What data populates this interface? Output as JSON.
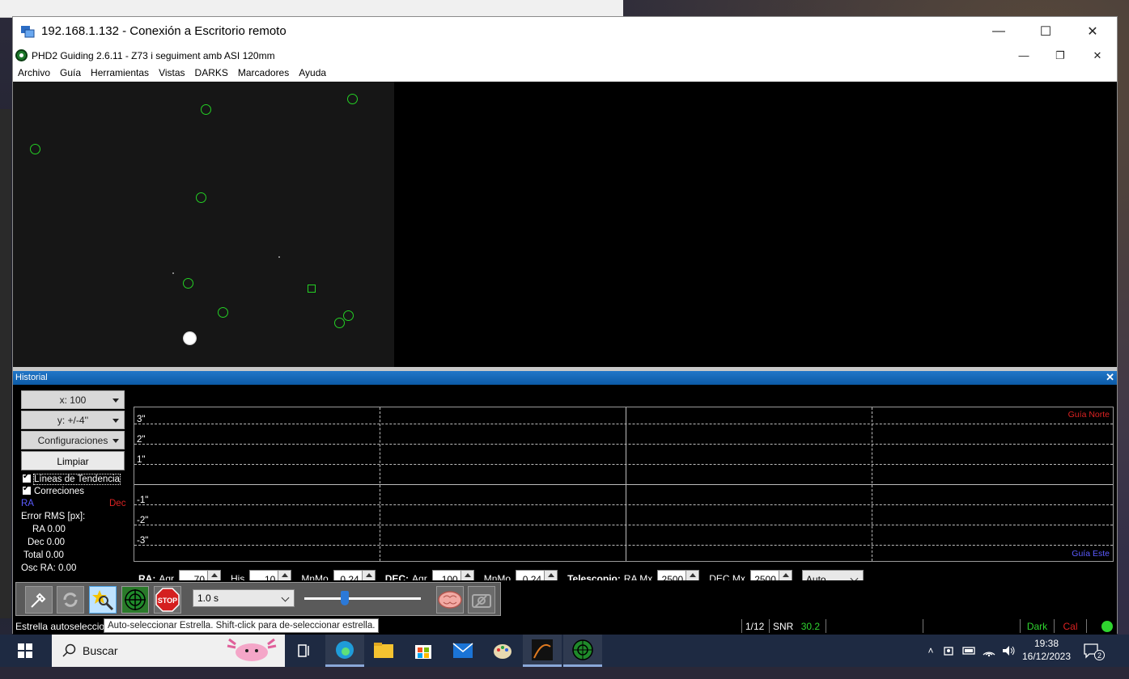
{
  "remote_window": {
    "title": "192.168.1.132 - Conexión a Escritorio remoto",
    "controls": {
      "minimize": "—",
      "maximize": "☐",
      "close": "✕"
    }
  },
  "app": {
    "title": "PHD2 Guiding 2.6.11 - Z73 i seguiment amb ASI 120mm",
    "controls": {
      "minimize": "—",
      "restore": "❐",
      "close": "✕"
    },
    "menu": [
      "Archivo",
      "Guía",
      "Herramientas",
      "Vistas",
      "DARKS",
      "Marcadores",
      "Ayuda"
    ]
  },
  "history": {
    "title": "Historial",
    "close": "✕",
    "x_scale": "x: 100",
    "y_scale": "y: +/-4''",
    "settings": "Configuraciones",
    "clear": "Limpiar",
    "trend_lines": "Líneas de Tendencia",
    "corrections": "Correciones",
    "ra_label": "RA",
    "dec_label": "Dec",
    "rms_title": "Error RMS [px]:",
    "rms_ra": "RA 0.00",
    "rms_dec": "Dec 0.00",
    "rms_total": "Total 0.00",
    "osc_ra": "Osc RA: 0.00",
    "graph": {
      "y_labels": [
        "3\"",
        "2\"",
        "1\"",
        "-1\"",
        "-2\"",
        "-3\""
      ],
      "north_label": "Guía Norte",
      "east_label": "Guía Este"
    }
  },
  "params": {
    "ra_title": "RA:",
    "agr_label": "Agr",
    "ra_agr": "70",
    "his_label": "His",
    "ra_his": "10",
    "mnmo_label": "MnMo",
    "ra_mnmo": "0.24",
    "dec_title": "DEC:",
    "dec_agr": "100",
    "dec_mnmo": "0.24",
    "scope_title": "Telescopio:",
    "ra_mx_label": "RA Mx",
    "ra_mx": "2500",
    "dec_mx_label": "DEC Mx",
    "dec_mx": "2500",
    "mode": "Auto"
  },
  "toolbar": {
    "exposure": "1.0 s",
    "exposure_level": 0.35,
    "icons": [
      "usb-connect-icon",
      "loop-icon",
      "auto-select-star-icon",
      "guide-icon",
      "stop-icon",
      "brain-icon",
      "camera-settings-icon"
    ],
    "stop_text": "STOP"
  },
  "status": {
    "left": "Estrella autoseleccio",
    "tooltip": "Auto-seleccionar Estrella. Shift-click para de-seleccionar estrella.",
    "frame": "1/12",
    "snr_label": "SNR",
    "snr_value": "30.2",
    "dark": "Dark",
    "cal": "Cal"
  },
  "taskbar": {
    "search_placeholder": "Buscar",
    "time": "19:38",
    "date": "16/12/2023",
    "notifications": "2"
  },
  "colors": {
    "star_marker": "#24d024",
    "ra": "#5b5bff",
    "dec": "#d22222",
    "snr": "#2fd42f",
    "dark_status": "#2fd42f",
    "cal_status": "#d22222"
  }
}
